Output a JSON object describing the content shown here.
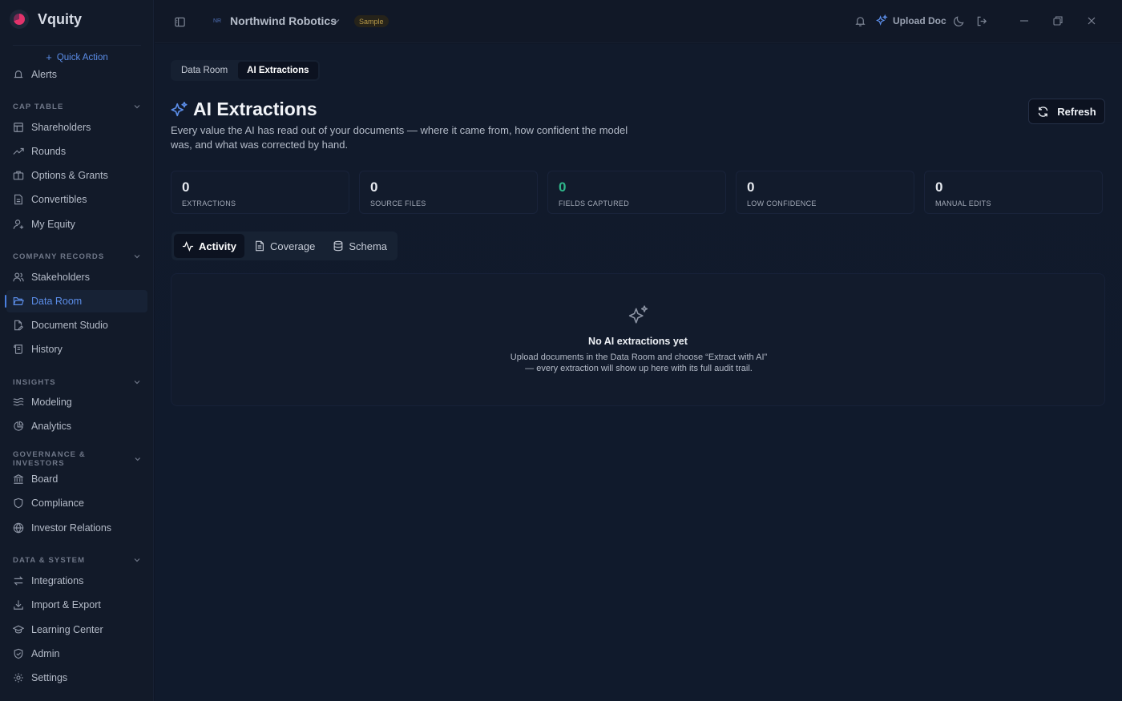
{
  "app": {
    "name": "Vquity"
  },
  "sidebar": {
    "quick_action": "Quick Action",
    "partial_item": "Alerts",
    "sections": [
      {
        "title": "CAP TABLE",
        "items": [
          "Shareholders",
          "Rounds",
          "Options & Grants",
          "Convertibles",
          "My Equity"
        ]
      },
      {
        "title": "COMPANY RECORDS",
        "items": [
          "Stakeholders",
          "Data Room",
          "Document Studio",
          "History"
        ]
      },
      {
        "title": "INSIGHTS",
        "items": [
          "Modeling",
          "Analytics"
        ]
      },
      {
        "title": "GOVERNANCE & INVESTORS",
        "items": [
          "Board",
          "Compliance",
          "Investor Relations"
        ]
      },
      {
        "title": "DATA & SYSTEM",
        "items": [
          "Integrations",
          "Import & Export",
          "Learning Center",
          "Admin",
          "Settings"
        ]
      }
    ],
    "active_item": "Data Room"
  },
  "topbar": {
    "org_initials": "NR",
    "org_name": "Northwind Robotics",
    "org_badge": "Sample",
    "upload_label": "Upload Doc"
  },
  "main": {
    "view_tabs": [
      "Data Room",
      "AI Extractions"
    ],
    "active_view_tab": "AI Extractions",
    "title": "AI Extractions",
    "description": "Every value the AI has read out of your documents — where it came from, how confident the model was, and what was corrected by hand.",
    "refresh_label": "Refresh",
    "stats": [
      {
        "value": "0",
        "label": "EXTRACTIONS"
      },
      {
        "value": "0",
        "label": "SOURCE FILES"
      },
      {
        "value": "0",
        "label": "FIELDS CAPTURED"
      },
      {
        "value": "0",
        "label": "LOW CONFIDENCE"
      },
      {
        "value": "0",
        "label": "MANUAL EDITS"
      }
    ],
    "sub_tabs": [
      "Activity",
      "Coverage",
      "Schema"
    ],
    "active_sub_tab": "Activity",
    "empty_state": {
      "title": "No AI extractions yet",
      "line1": "Upload documents in the Data Room and choose “Extract with AI”",
      "line2": "— every extraction will show up here with its full audit trail."
    }
  },
  "colors": {
    "accent": "#5b8de8",
    "success": "#2fb68a",
    "background": "#0f1626",
    "sidebar": "#121a29"
  }
}
